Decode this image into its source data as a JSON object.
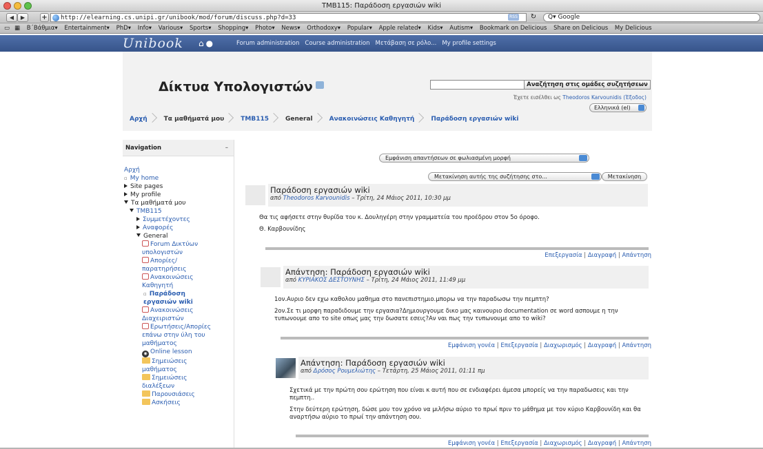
{
  "browser": {
    "window_title": "TMB115: Παράδοση εργασιών wiki",
    "url": "http://elearning.cs.unipi.gr/unibook/mod/forum/discuss.php?d=33",
    "rss": "RSS",
    "search_placeholder": "Google",
    "bookmarks": [
      "Β΄Βάθμια▾",
      "Entertainment▾",
      "PhD▾",
      "Info▾",
      "Various▾",
      "Sports▾",
      "Shopping▾",
      "Photo▾",
      "News▾",
      "Orthodoxy▾",
      "Popular▾",
      "Apple related▾",
      "Kids▾",
      "Autism▾",
      "Bookmark on Delicious",
      "Share on Delicious",
      "My Delicious"
    ]
  },
  "topbar": {
    "logo": "Unibook",
    "nav": [
      "Forum administration",
      "Course administration",
      "Μετάβαση σε ρόλο...",
      "My profile settings"
    ]
  },
  "header": {
    "site_title": "Δίκτυα Υπολογιστών",
    "logged_in_prefix": "Έχετε εισέλθει ως",
    "user_name": "Theodoros Karvounidis",
    "logout": "(Έξοδος)",
    "language": "Ελληνικά (el)",
    "breadcrumbs": [
      "Αρχή",
      "Τα μαθήματά μου",
      "TMB115",
      "General",
      "Ανακοινώσεις Καθηγητή",
      "Παράδοση εργασιών wiki"
    ],
    "search_button": "Αναζήτηση στις ομάδες συζητήσεων"
  },
  "sidebar": {
    "title": "Navigation",
    "collapse": "–",
    "items": [
      {
        "label": "Αρχή"
      },
      {
        "label": "My home"
      },
      {
        "label": "Site pages"
      },
      {
        "label": "My profile"
      },
      {
        "label": "Τα μαθήματά μου"
      },
      {
        "label": "TMB115"
      },
      {
        "label": "Συμμετέχοντες"
      },
      {
        "label": "Αναφορές"
      },
      {
        "label": "General"
      },
      {
        "label": "Forum Δικτύων υπολογιστών"
      },
      {
        "label": "Απορίες/ παρατηρήσεις"
      },
      {
        "label": "Ανακοινώσεις Καθηγητή"
      },
      {
        "label": "Παράδοση εργασιών wiki"
      },
      {
        "label": "Ανακοινώσεις Διαχειριστών"
      },
      {
        "label": "Ερωτήσεις/Απορίες επάνω στην ύλη του μαθήματος"
      },
      {
        "label": "Online lesson"
      },
      {
        "label": "Σημειώσεις μαθήματος"
      },
      {
        "label": "Σημειώσεις διαλέξεων"
      },
      {
        "label": "Παρουσιάσεις"
      },
      {
        "label": "Ασκήσεις"
      }
    ]
  },
  "main": {
    "display_mode": "Εμφάνιση απαντήσεων σε φωλιασμένη μορφή",
    "move_select": "Μετακίνηση αυτής της συζήτησης στο...",
    "move_button": "Μετακίνηση",
    "posts": [
      {
        "title": "Παράδοση εργασιών wiki",
        "by": "από",
        "author": "Theodoros Karvounidis",
        "date": " – Τρίτη, 24 Μάιος 2011, 10:30 μμ",
        "body": [
          "Θα τις αφήσετε στην θυρίδα του κ. Δουληγέρη στην γραμματεία του προέδρου στον 5ο όροφο.",
          "Θ. Καρβουνίδης"
        ],
        "commands": [
          "Επεξεργασία",
          "Διαγραφή",
          "Απάντηση"
        ]
      },
      {
        "title": "Απάντηση: Παράδοση εργασιών wiki",
        "by": "από",
        "author": "ΚΥΡΙΑΚΟΣ ΔΕΣΤΟΥΝΗΣ",
        "date": " – Τρίτη, 24 Μάιος 2011, 11:49 μμ",
        "body": [
          "1ον.Αυριο δεν εχω καθολου μαθημα στο πανεπιστημιο.μπορω να την παραδωσω την πεμπτη?",
          "2ον.Σε τι μορφη παραδιδουμε την εργασια?Δημιουργουμε δικο μας καινουριο documentation σε word ασπουμε η την τυπωνουμε απο το site οπως μας την δωσατε εσεις?Αν ναι πως την τυπωνουμε απο το wiki?"
        ],
        "commands": [
          "Εμφάνιση γονέα",
          "Επεξεργασία",
          "Διαχωρισμός",
          "Διαγραφή",
          "Απάντηση"
        ]
      },
      {
        "title": "Απάντηση: Παράδοση εργασιών wiki",
        "by": "από",
        "author": "Δρόσος Ρουμελιώτης",
        "date": " – Τετάρτη, 25 Μάιος 2011, 01:11 πμ",
        "body": [
          "Σχετικά με την πρώτη σου ερώτηση που είναι κ αυτή που σε ενδιαφέρει άμεσα μπορείς να την παραδωσεις και την πεμπτη..",
          "Στην δεύτερη ερώτηση, δώσε μου τον χρόνο να μιλήσω αύριο το πρωί πριν το μάθημα με τον κύριο Καρβουνίδη και θα αναρτήσω αύριο το πρωί την απάντηση σου."
        ],
        "commands": [
          "Εμφάνιση γονέα",
          "Επεξεργασία",
          "Διαχωρισμός",
          "Διαγραφή",
          "Απάντηση"
        ]
      }
    ]
  }
}
